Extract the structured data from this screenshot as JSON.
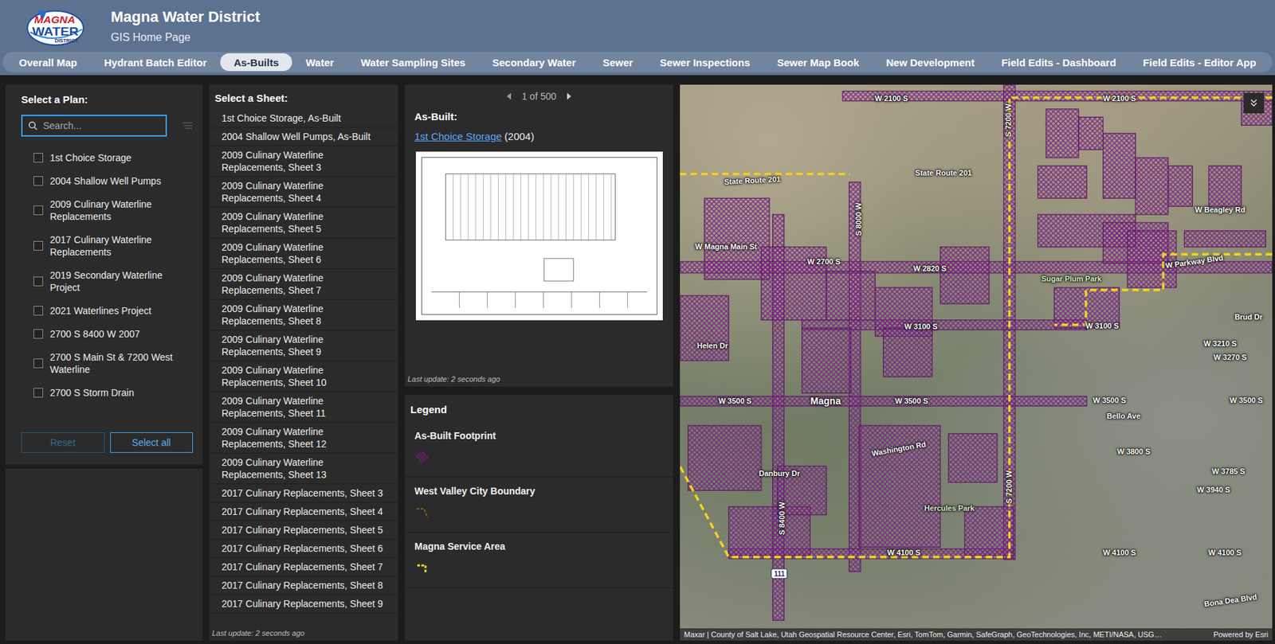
{
  "header": {
    "logo": {
      "top": "MAGNA",
      "middle": "WATER",
      "bottom": "DISTRICT"
    },
    "title": "Magna Water District",
    "subtitle": "GIS Home Page"
  },
  "tabs": [
    {
      "label": "Overall Map",
      "selected": false
    },
    {
      "label": "Hydrant Batch Editor",
      "selected": false
    },
    {
      "label": "As-Builts",
      "selected": true
    },
    {
      "label": "Water",
      "selected": false
    },
    {
      "label": "Water Sampling Sites",
      "selected": false
    },
    {
      "label": "Secondary Water",
      "selected": false
    },
    {
      "label": "Sewer",
      "selected": false
    },
    {
      "label": "Sewer Inspections",
      "selected": false
    },
    {
      "label": "Sewer Map Book",
      "selected": false
    },
    {
      "label": "New Development",
      "selected": false
    },
    {
      "label": "Field Edits - Dashboard",
      "selected": false
    },
    {
      "label": "Field Edits - Editor App",
      "selected": false
    }
  ],
  "plans": {
    "title": "Select a Plan:",
    "search": {
      "placeholder": "Search...",
      "value": "",
      "focused": true
    },
    "items": [
      {
        "label": "1st Choice Storage",
        "checked": false
      },
      {
        "label": "2004 Shallow Well Pumps",
        "checked": false
      },
      {
        "label": "2009 Culinary Waterline Replacements",
        "checked": false
      },
      {
        "label": "2017 Culinary Waterline Replacements",
        "checked": false
      },
      {
        "label": "2019 Secondary Waterline Project",
        "checked": false
      },
      {
        "label": "2021 Waterlines Project",
        "checked": false
      },
      {
        "label": "2700 S 8400 W 2007",
        "checked": false
      },
      {
        "label": "2700 S Main St & 7200 West Waterline",
        "checked": false
      },
      {
        "label": "2700 S Storm Drain",
        "checked": false
      }
    ],
    "buttons": [
      {
        "label": "Reset",
        "disabled": true
      },
      {
        "label": "Select all",
        "disabled": false
      }
    ]
  },
  "sheets": {
    "title": "Select a Sheet:",
    "footer": "Last update: 2 seconds ago",
    "items": [
      {
        "label": "1st Choice Storage, As-Built",
        "selected": false
      },
      {
        "label": "2004 Shallow Well Pumps, As-Built",
        "selected": false
      },
      {
        "label": "2009 Culinary Waterline Replacements, Sheet 3",
        "selected": false
      },
      {
        "label": "2009 Culinary Waterline Replacements, Sheet 4",
        "selected": false
      },
      {
        "label": "2009 Culinary Waterline Replacements, Sheet 5",
        "selected": false
      },
      {
        "label": "2009 Culinary Waterline Replacements, Sheet 6",
        "selected": false
      },
      {
        "label": "2009 Culinary Waterline Replacements, Sheet 7",
        "selected": false
      },
      {
        "label": "2009 Culinary Waterline Replacements, Sheet 8",
        "selected": false
      },
      {
        "label": "2009 Culinary Waterline Replacements, Sheet 9",
        "selected": false
      },
      {
        "label": "2009 Culinary Waterline Replacements, Sheet 10",
        "selected": false
      },
      {
        "label": "2009 Culinary Waterline Replacements, Sheet 11",
        "selected": false
      },
      {
        "label": "2009 Culinary Waterline Replacements, Sheet 12",
        "selected": false
      },
      {
        "label": "2009 Culinary Waterline Replacements, Sheet 13",
        "selected": false
      },
      {
        "label": "2017 Culinary Replacements, Sheet 3",
        "selected": false
      },
      {
        "label": "2017 Culinary Replacements, Sheet 4",
        "selected": false
      },
      {
        "label": "2017 Culinary Replacements, Sheet 5",
        "selected": false
      },
      {
        "label": "2017 Culinary Replacements, Sheet 6",
        "selected": false
      },
      {
        "label": "2017 Culinary Replacements, Sheet 7",
        "selected": false
      },
      {
        "label": "2017 Culinary Replacements, Sheet 8",
        "selected": false
      },
      {
        "label": "2017 Culinary Replacements, Sheet 9",
        "selected": false
      }
    ]
  },
  "details": {
    "pager": "1 of 500",
    "heading": "As-Built:",
    "link": "1st Choice Storage",
    "year": "(2004)",
    "footer": "Last update: 2 seconds ago"
  },
  "legend": {
    "title": "Legend",
    "items": [
      {
        "label": "As-Built Footprint",
        "kind": "footprint",
        "color": "#6a1f6e"
      },
      {
        "label": "West Valley City Boundary",
        "kind": "boundary",
        "color": "#8a5a1e"
      },
      {
        "label": "Magna Service Area",
        "kind": "service",
        "color": "#f2d21b"
      }
    ]
  },
  "map": {
    "labels": [
      {
        "text": "W 2100 S",
        "kind": "street"
      },
      {
        "text": "W 2100 S",
        "kind": "street"
      },
      {
        "text": "State Route 201",
        "kind": "street"
      },
      {
        "text": "State Route 201",
        "kind": "street"
      },
      {
        "text": "W Beagley Rd",
        "kind": "street"
      },
      {
        "text": "W Magna Main St",
        "kind": "street"
      },
      {
        "text": "W 2700 S",
        "kind": "street"
      },
      {
        "text": "W 2820 S",
        "kind": "street"
      },
      {
        "text": "W Parkway Blvd",
        "kind": "street"
      },
      {
        "text": "Sugar Plum Park",
        "kind": "place"
      },
      {
        "text": "W 3100 S",
        "kind": "street"
      },
      {
        "text": "W 3100 S",
        "kind": "street"
      },
      {
        "text": "Brud Dr",
        "kind": "street"
      },
      {
        "text": "W 3210 S",
        "kind": "street"
      },
      {
        "text": "W 3270 S",
        "kind": "street"
      },
      {
        "text": "Helen Dr",
        "kind": "street"
      },
      {
        "text": "Magna",
        "kind": "city"
      },
      {
        "text": "W 3500 S",
        "kind": "street"
      },
      {
        "text": "W 3500 S",
        "kind": "street"
      },
      {
        "text": "W 3500 S",
        "kind": "street"
      },
      {
        "text": "W 3500 S",
        "kind": "street"
      },
      {
        "text": "Bello Ave",
        "kind": "street"
      },
      {
        "text": "Washington Rd",
        "kind": "street"
      },
      {
        "text": "Danbury Dr",
        "kind": "street"
      },
      {
        "text": "W 3800 S",
        "kind": "street"
      },
      {
        "text": "W 3785 S",
        "kind": "street"
      },
      {
        "text": "W 3940 S",
        "kind": "street"
      },
      {
        "text": "Hercules Park",
        "kind": "place"
      },
      {
        "text": "W 4100 S",
        "kind": "street"
      },
      {
        "text": "W 4100 S",
        "kind": "street"
      },
      {
        "text": "W 4100 S",
        "kind": "street"
      },
      {
        "text": "Bona Dea Blvd",
        "kind": "street"
      },
      {
        "text": "S 7200 W",
        "kind": "street"
      },
      {
        "text": "S 8000 W",
        "kind": "street"
      },
      {
        "text": "S 7200 W",
        "kind": "street"
      },
      {
        "text": "S 8400 W",
        "kind": "street"
      },
      {
        "text": "111",
        "kind": "shield"
      }
    ],
    "attribution": "Maxar | County of Salt Lake, Utah Geospatial Resource Center, Esri, TomTom, Garmin, SafeGraph, GeoTechnologies, Inc, METI/NASA, USG…",
    "powered": "Powered by Esri"
  }
}
